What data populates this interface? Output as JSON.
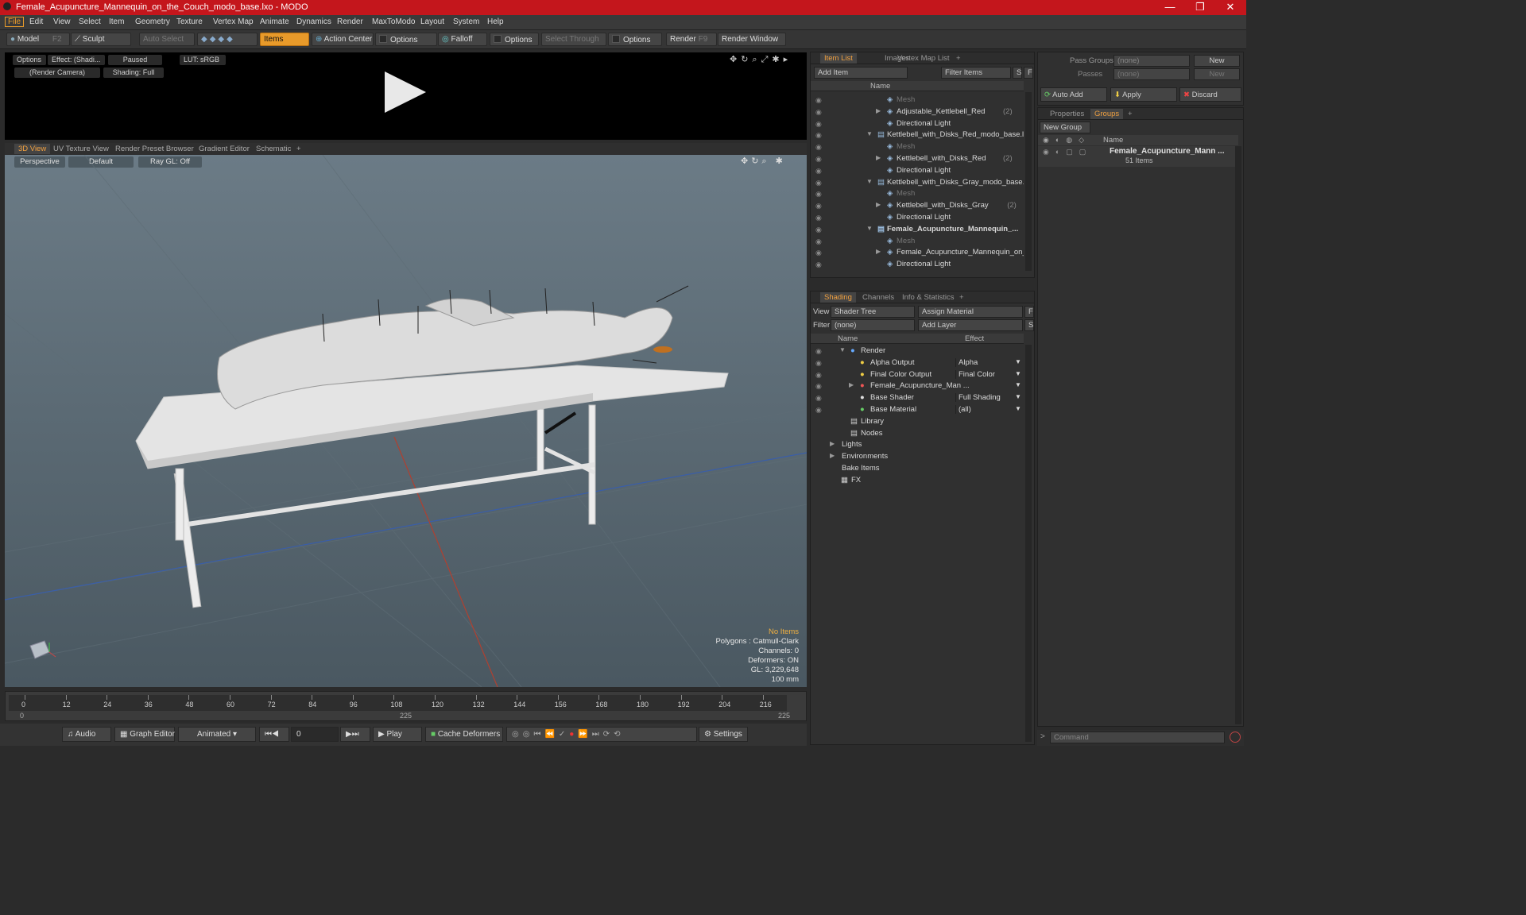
{
  "window": {
    "title": "Female_Acupuncture_Mannequin_on_the_Couch_modo_base.lxo - MODO",
    "min": "—",
    "max": "❐",
    "close": "✕"
  },
  "menu": [
    "File",
    "Edit",
    "View",
    "Select",
    "Item",
    "Geometry",
    "Texture",
    "Vertex Map",
    "Animate",
    "Dynamics",
    "Render",
    "MaxToModo",
    "Layout",
    "System",
    "Help"
  ],
  "toolbar": {
    "model": "Model",
    "model_key": "F2",
    "sculpt": "Sculpt",
    "auto_select": "Auto Select",
    "items": "Items",
    "action_center": "Action Center",
    "options1": "Options",
    "falloff": "Falloff",
    "options2": "Options",
    "select_through": "Select Through",
    "options3": "Options",
    "render": "Render",
    "render_key": "F9",
    "render_window": "Render Window"
  },
  "preview": {
    "options": "Options",
    "effect": "Effect: (Shadi...",
    "paused": "Paused",
    "lut": "LUT: sRGB",
    "camera": "(Render Camera)",
    "shading": "Shading: Full"
  },
  "viewtabs": [
    "3D View",
    "UV Texture View",
    "Render Preset Browser",
    "Gradient Editor",
    "Schematic",
    "+"
  ],
  "viewport": {
    "perspective": "Perspective",
    "default": "Default",
    "raygl": "Ray GL: Off",
    "info": [
      "No Items",
      "Polygons : Catmull-Clark",
      "Channels: 0",
      "Deformers: ON",
      "GL: 3,229,648",
      "100 mm"
    ]
  },
  "timeline": {
    "ticks": [
      "0",
      "12",
      "24",
      "36",
      "48",
      "60",
      "72",
      "84",
      "96",
      "108",
      "120",
      "132",
      "144",
      "156",
      "168",
      "180",
      "192",
      "204",
      "216"
    ],
    "start": "0",
    "mid": "225",
    "end": "225"
  },
  "transport": {
    "audio": "Audio",
    "graph_editor": "Graph Editor",
    "animated": "Animated",
    "frame": "0",
    "play": "Play",
    "cache": "Cache Deformers",
    "settings": "Settings"
  },
  "itemlist": {
    "tabs": [
      "Item List",
      "Images",
      "Vertex Map List",
      "+"
    ],
    "add_item": "Add Item",
    "filter": "Filter Items",
    "s": "S",
    "f": "F",
    "col_name": "Name",
    "rows": [
      {
        "t": "Mesh",
        "d": 3,
        "dim": true,
        "arrow": ""
      },
      {
        "t": "Adjustable_Kettlebell_Red",
        "c": "(2)",
        "d": 3,
        "arrow": "▶"
      },
      {
        "t": "Directional Light",
        "d": 3,
        "arrow": ""
      },
      {
        "t": "Kettlebell_with_Disks_Red_modo_base.lxo",
        "d": 2,
        "arrow": "▼"
      },
      {
        "t": "Mesh",
        "d": 3,
        "dim": true,
        "arrow": ""
      },
      {
        "t": "Kettlebell_with_Disks_Red",
        "c": "(2)",
        "d": 3,
        "arrow": "▶"
      },
      {
        "t": "Directional Light",
        "d": 3,
        "arrow": ""
      },
      {
        "t": "Kettlebell_with_Disks_Gray_modo_base.lxo",
        "d": 2,
        "arrow": "▼"
      },
      {
        "t": "Mesh",
        "d": 3,
        "dim": true,
        "arrow": ""
      },
      {
        "t": "Kettlebell_with_Disks_Gray",
        "c": "(2)",
        "d": 3,
        "arrow": "▶"
      },
      {
        "t": "Directional Light",
        "d": 3,
        "arrow": ""
      },
      {
        "t": "Female_Acupuncture_Mannequin_...",
        "d": 2,
        "arrow": "▼",
        "bold": true
      },
      {
        "t": "Mesh",
        "d": 3,
        "dim": true,
        "arrow": ""
      },
      {
        "t": "Female_Acupuncture_Mannequin_on_...",
        "d": 3,
        "arrow": "▶"
      },
      {
        "t": "Directional Light",
        "d": 3,
        "arrow": ""
      }
    ]
  },
  "shading": {
    "tabs": [
      "Shading",
      "Channels",
      "Info & Statistics",
      "+"
    ],
    "view_label": "View",
    "view": "Shader Tree",
    "assign": "Assign Material",
    "filter_label": "Filter",
    "filter": "(none)",
    "add_layer": "Add Layer",
    "f": "F",
    "s": "S",
    "col_name": "Name",
    "col_effect": "Effect",
    "rows": [
      {
        "t": "Render",
        "e": "",
        "d": 1,
        "arrow": "▼"
      },
      {
        "t": "Alpha Output",
        "e": "Alpha",
        "d": 2,
        "arrow": ""
      },
      {
        "t": "Final Color Output",
        "e": "Final Color",
        "d": 2,
        "arrow": ""
      },
      {
        "t": "Female_Acupuncture_Man ...",
        "e": "",
        "d": 2,
        "arrow": "▶"
      },
      {
        "t": "Base Shader",
        "e": "Full Shading",
        "d": 2,
        "arrow": ""
      },
      {
        "t": "Base Material",
        "e": "(all)",
        "d": 2,
        "arrow": ""
      },
      {
        "t": "Library",
        "e": "",
        "d": 1,
        "arrow": ""
      },
      {
        "t": "Nodes",
        "e": "",
        "d": 1,
        "arrow": ""
      },
      {
        "t": "Lights",
        "e": "",
        "d": 0,
        "arrow": "▶"
      },
      {
        "t": "Environments",
        "e": "",
        "d": 0,
        "arrow": "▶"
      },
      {
        "t": "Bake Items",
        "e": "",
        "d": 0,
        "arrow": ""
      },
      {
        "t": "FX",
        "e": "",
        "d": 0,
        "arrow": ""
      }
    ]
  },
  "right": {
    "pass_groups": "Pass Groups",
    "passes": "Passes",
    "none1": "(none)",
    "none2": "(none)",
    "new1": "New",
    "new2": "New",
    "auto_add": "Auto Add",
    "apply": "Apply",
    "discard": "Discard",
    "tabs": [
      "Properties",
      "Groups",
      "+"
    ],
    "new_group": "New Group",
    "col_name": "Name",
    "group_name": "Female_Acupuncture_Mann ...",
    "group_count": "51 Items",
    "command": "Command"
  }
}
